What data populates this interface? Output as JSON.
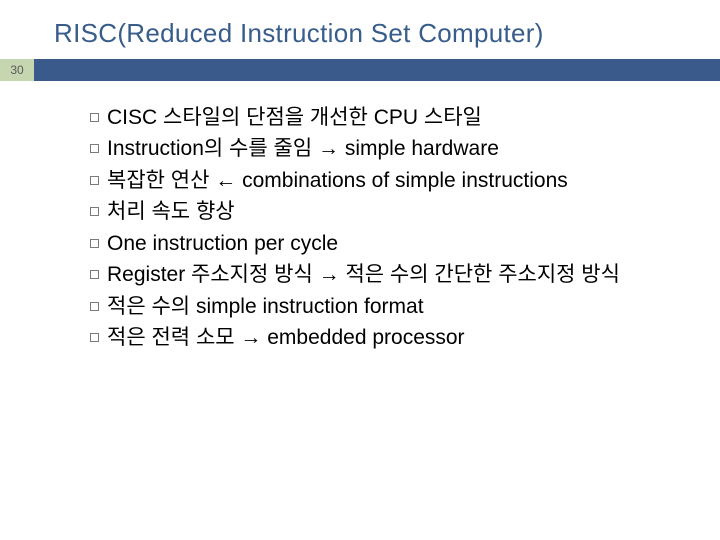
{
  "slide": {
    "title": "RISC(Reduced Instruction Set Computer)",
    "page_number": "30",
    "bullets": [
      "CISC 스타일의 단점을 개선한 CPU 스타일",
      "Instruction의 수를 줄임 → simple hardware",
      "복잡한 연산 ← combinations of simple instructions",
      "처리 속도 향상",
      "One instruction per cycle",
      "Register 주소지정 방식 → 적은 수의 간단한 주소지정 방식",
      "적은 수의 simple instruction format",
      "적은 전력 소모 → embedded processor"
    ]
  }
}
